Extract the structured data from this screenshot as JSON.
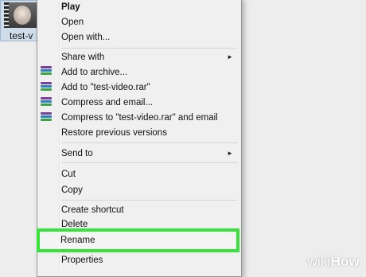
{
  "file": {
    "name": "test-v"
  },
  "menu": {
    "items": [
      {
        "label": "Play"
      },
      {
        "label": "Open"
      },
      {
        "label": "Open with..."
      },
      {
        "label": "Share with"
      },
      {
        "label": "Add to archive..."
      },
      {
        "label": "Add to \"test-video.rar\""
      },
      {
        "label": "Compress and email..."
      },
      {
        "label": "Compress to \"test-video.rar\" and email"
      },
      {
        "label": "Restore previous versions"
      },
      {
        "label": "Send to"
      },
      {
        "label": "Cut"
      },
      {
        "label": "Copy"
      },
      {
        "label": "Create shortcut"
      },
      {
        "label": "Delete"
      },
      {
        "label": "Rename"
      },
      {
        "label": "Properties"
      }
    ],
    "submenu_arrow": "►"
  },
  "highlight_color": "#37e23a",
  "watermark": {
    "prefix": "wiki",
    "suffix": "How"
  }
}
